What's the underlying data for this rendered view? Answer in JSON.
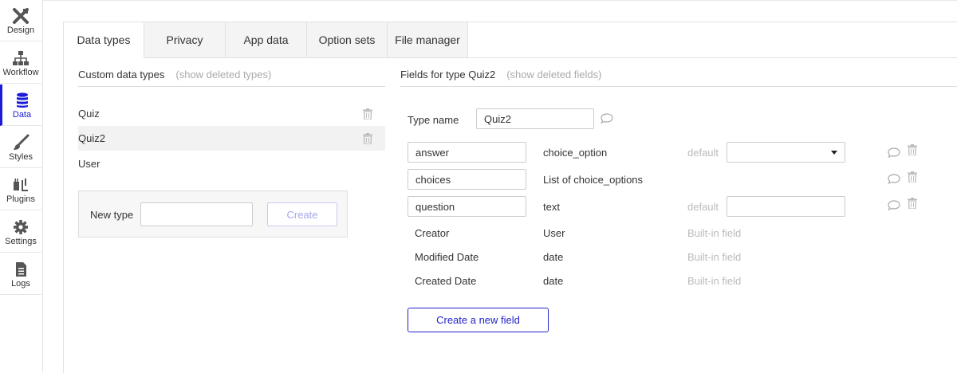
{
  "sidebar": {
    "items": [
      {
        "label": "Design",
        "icon": "design-icon"
      },
      {
        "label": "Workflow",
        "icon": "workflow-icon"
      },
      {
        "label": "Data",
        "icon": "database-icon"
      },
      {
        "label": "Styles",
        "icon": "brush-icon"
      },
      {
        "label": "Plugins",
        "icon": "plug-icon"
      },
      {
        "label": "Settings",
        "icon": "gear-icon"
      },
      {
        "label": "Logs",
        "icon": "document-icon"
      }
    ],
    "active": "Data",
    "accent_color": "#1a1ad8"
  },
  "tabs": [
    {
      "label": "Data types",
      "active": true
    },
    {
      "label": "Privacy"
    },
    {
      "label": "App data"
    },
    {
      "label": "Option sets"
    },
    {
      "label": "File manager"
    }
  ],
  "custom_types": {
    "heading": "Custom data types",
    "show_deleted": "(show deleted types)",
    "items": [
      {
        "name": "Quiz"
      },
      {
        "name": "Quiz2",
        "selected": true
      },
      {
        "name": "User"
      }
    ],
    "new_type_label": "New type",
    "new_type_value": "",
    "create_label": "Create"
  },
  "fields": {
    "heading": "Fields for type Quiz2",
    "show_deleted": "(show deleted fields)",
    "type_name_label": "Type name",
    "type_name_value": "Quiz2",
    "default_label": "default",
    "rows": [
      {
        "name": "answer",
        "type": "choice_option",
        "default_kind": "dropdown",
        "default_value": ""
      },
      {
        "name": "choices",
        "type": "List of choice_options"
      },
      {
        "name": "question",
        "type": "text",
        "default_kind": "input",
        "default_value": ""
      }
    ],
    "builtin": [
      {
        "name": "Creator",
        "type": "User",
        "note": "Built-in field"
      },
      {
        "name": "Modified Date",
        "type": "date",
        "note": "Built-in field"
      },
      {
        "name": "Created Date",
        "type": "date",
        "note": "Built-in field"
      }
    ],
    "create_field_label": "Create a new field",
    "button_color": "#2323c8"
  }
}
